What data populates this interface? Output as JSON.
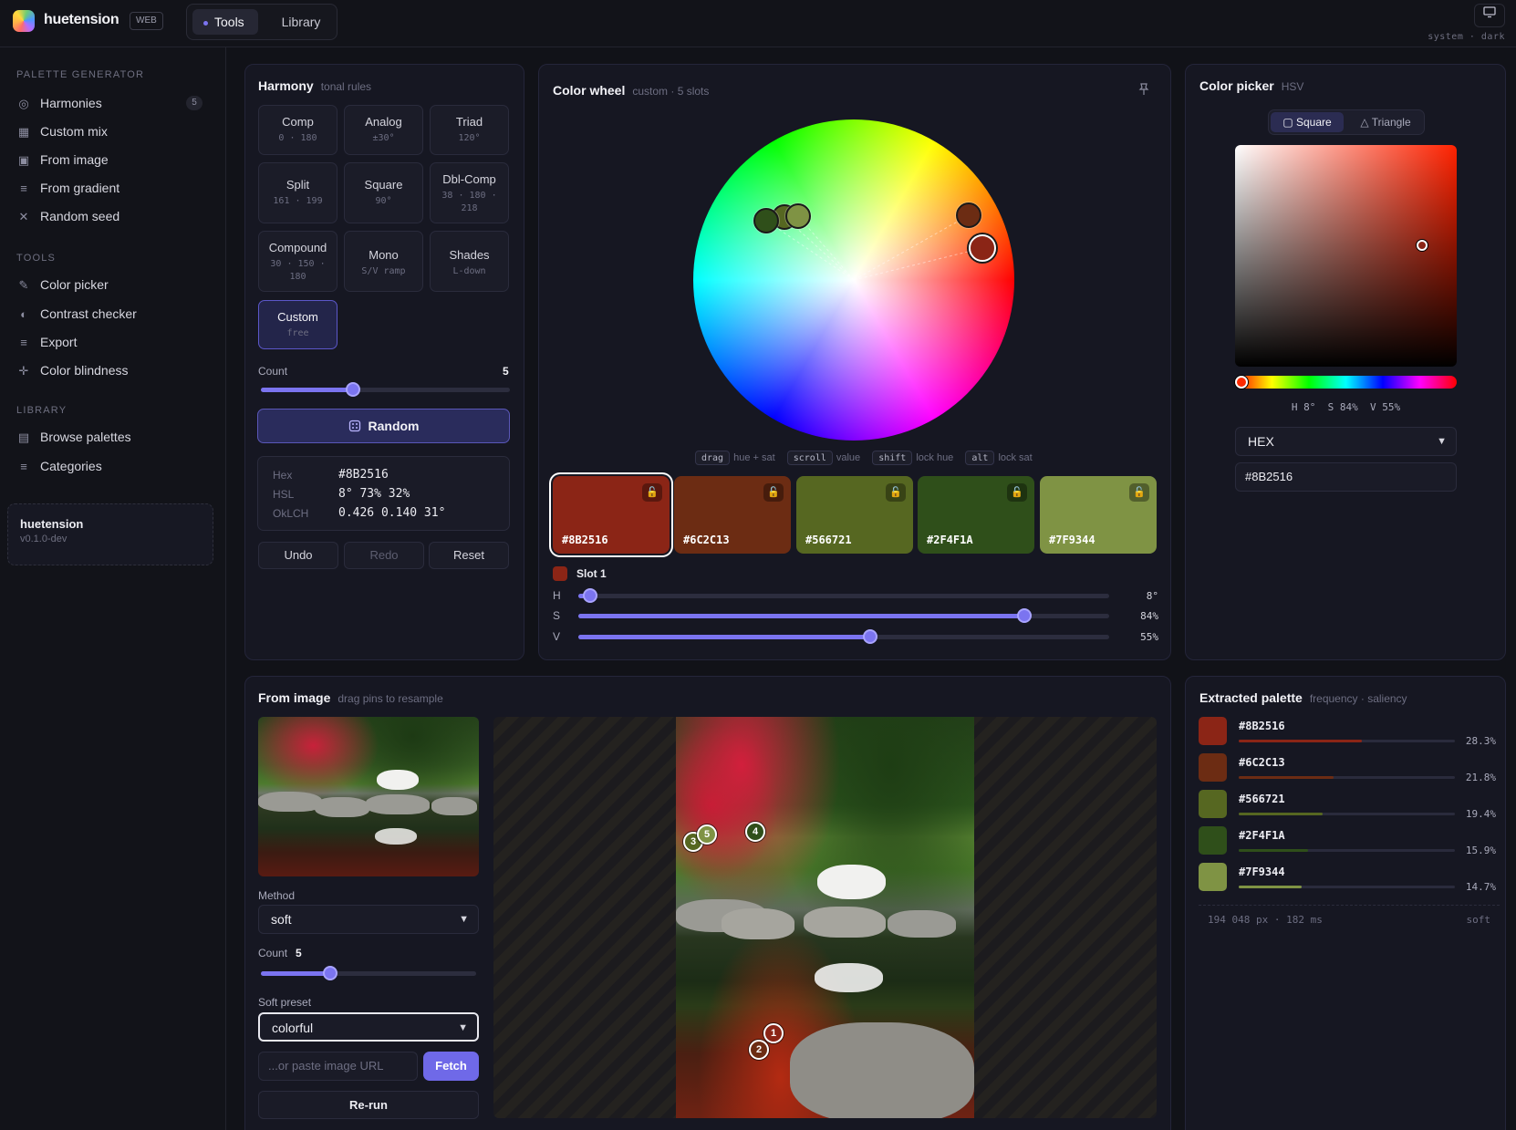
{
  "app": {
    "name": "huetension",
    "badge": "WEB",
    "theme_status": "system · dark"
  },
  "nav": {
    "tabs": [
      {
        "label": "Tools",
        "active": true
      },
      {
        "label": "Library",
        "active": false
      }
    ]
  },
  "sidebar": {
    "sections": [
      {
        "title": "PALETTE GENERATOR",
        "items": [
          {
            "label": "Harmonies",
            "icon": "circle-dot-icon",
            "count": "5"
          },
          {
            "label": "Custom mix",
            "icon": "grid-icon"
          },
          {
            "label": "From image",
            "icon": "image-icon"
          },
          {
            "label": "From gradient",
            "icon": "lines-icon"
          },
          {
            "label": "Random seed",
            "icon": "x-icon"
          }
        ]
      },
      {
        "title": "TOOLS",
        "items": [
          {
            "label": "Color picker",
            "icon": "pencil-icon"
          },
          {
            "label": "Contrast checker",
            "icon": "contrast-icon"
          },
          {
            "label": "Export",
            "icon": "lines-icon"
          },
          {
            "label": "Color blindness",
            "icon": "crosshair-icon"
          }
        ]
      },
      {
        "title": "LIBRARY",
        "items": [
          {
            "label": "Browse palettes",
            "icon": "book-icon"
          },
          {
            "label": "Categories",
            "icon": "lines-icon"
          }
        ]
      }
    ],
    "card": {
      "title": "huetension",
      "version": "v0.1.0-dev"
    }
  },
  "harmony": {
    "title": "Harmony",
    "subtitle": "tonal rules",
    "buttons": [
      {
        "label": "Comp",
        "detail": "0 · 180"
      },
      {
        "label": "Analog",
        "detail": "±30°"
      },
      {
        "label": "Triad",
        "detail": "120°"
      },
      {
        "label": "Split",
        "detail": "161 · 199"
      },
      {
        "label": "Square",
        "detail": "90°"
      },
      {
        "label": "Dbl-Comp",
        "detail": "38 · 180 · 218"
      },
      {
        "label": "Compound",
        "detail": "30 · 150 · 180"
      },
      {
        "label": "Mono",
        "detail": "S/V ramp"
      },
      {
        "label": "Shades",
        "detail": "L-down"
      },
      {
        "label": "Custom",
        "detail": "free",
        "active": true
      }
    ],
    "count_label": "Count",
    "count_value": "5",
    "count_fraction": 0.37,
    "random_label": "Random",
    "info": [
      {
        "key": "Hex",
        "value": "#8B2516"
      },
      {
        "key": "HSL",
        "value": "8° 73% 32%"
      },
      {
        "key": "OkLCH",
        "value": "0.426 0.140 31°"
      }
    ],
    "undo_label": "Undo",
    "redo_label": "Redo",
    "reset_label": "Reset"
  },
  "wheel": {
    "title": "Color wheel",
    "subtitle": "custom · 5 slots",
    "hints": [
      {
        "key": "drag",
        "text": "hue + sat"
      },
      {
        "key": "scroll",
        "text": "value"
      },
      {
        "key": "shift",
        "text": "lock hue"
      },
      {
        "key": "alt",
        "text": "lock sat"
      }
    ],
    "swatches": [
      {
        "hex": "#8B2516",
        "color": "#8B2516",
        "selected": true
      },
      {
        "hex": "#6C2C13",
        "color": "#6C2C13"
      },
      {
        "hex": "#566721",
        "color": "#566721"
      },
      {
        "hex": "#2F4F1A",
        "color": "#2F4F1A"
      },
      {
        "hex": "#7F9344",
        "color": "#7F9344"
      }
    ],
    "slot": {
      "label": "Slot 1",
      "color": "#8B2516",
      "h_label": "H",
      "h_value": "8°",
      "h_fraction": 0.022,
      "s_label": "S",
      "s_value": "84%",
      "s_fraction": 0.84,
      "v_label": "V",
      "v_value": "55%",
      "v_fraction": 0.55
    }
  },
  "picker": {
    "title": "Color picker",
    "subtitle": "HSV",
    "modes": [
      {
        "label": "Square",
        "active": true
      },
      {
        "label": "Triangle",
        "active": false
      }
    ],
    "readout": "H 8°  S 84%  V 55%",
    "format": "HEX",
    "value": "#8B2516"
  },
  "from_image": {
    "title": "From image",
    "subtitle": "drag pins to resample",
    "method_label": "Method",
    "method_value": "soft",
    "count_label": "Count",
    "count_value": "5",
    "count_fraction": 0.32,
    "preset_label": "Soft preset",
    "preset_value": "colorful",
    "url_placeholder": "...or paste image URL",
    "fetch_label": "Fetch",
    "rerun_label": "Re-run",
    "pins": [
      "1",
      "2",
      "3",
      "4",
      "5"
    ]
  },
  "extracted": {
    "title": "Extracted palette",
    "subtitle": "frequency · saliency",
    "rows": [
      {
        "hex": "#8B2516",
        "color": "#8B2516",
        "pct": "28.3%",
        "fraction": 0.283
      },
      {
        "hex": "#6C2C13",
        "color": "#6C2C13",
        "pct": "21.8%",
        "fraction": 0.218
      },
      {
        "hex": "#566721",
        "color": "#566721",
        "pct": "19.4%",
        "fraction": 0.194
      },
      {
        "hex": "#2F4F1A",
        "color": "#2F4F1A",
        "pct": "15.9%",
        "fraction": 0.159
      },
      {
        "hex": "#7F9344",
        "color": "#7F9344",
        "pct": "14.7%",
        "fraction": 0.147
      }
    ],
    "footer_left": "194 048 px · 182 ms",
    "footer_right": "soft"
  }
}
